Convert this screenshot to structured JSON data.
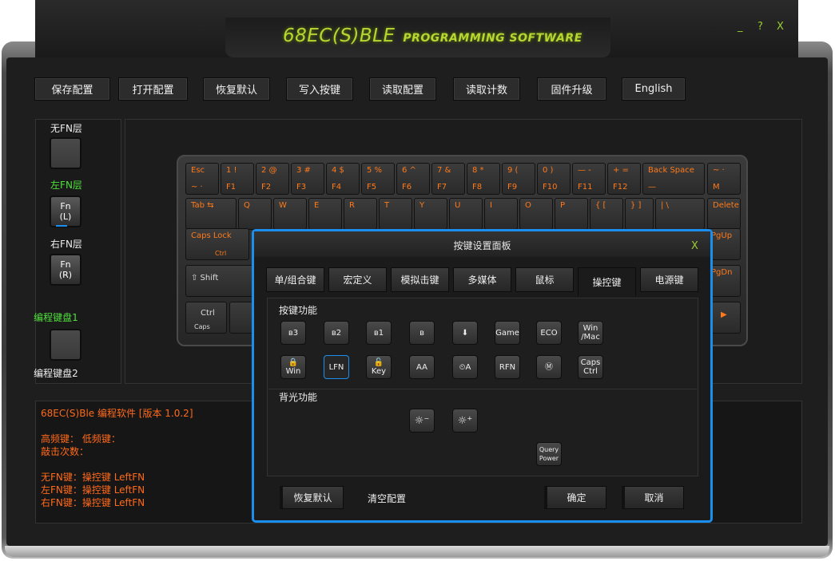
{
  "app": {
    "title_main": "68EC(S)BLE",
    "title_sub": "PROGRAMMING SOFTWARE",
    "min_label": "_",
    "help_label": "?",
    "close_label": "X"
  },
  "toolbar": [
    "保存配置",
    "打开配置",
    "恢复默认",
    "写入按键",
    "读取配置",
    "读取计数",
    "固件升级",
    "English"
  ],
  "layers": {
    "no_fn": "无FN层",
    "left_fn": "左FN层",
    "left_fn_key": "Fn",
    "left_fn_sub": "(L)",
    "right_fn": "右FN层",
    "right_fn_key": "Fn",
    "right_fn_sub": "(R)",
    "kb1": "编程键盘1",
    "kb2": "编程键盘2"
  },
  "keyboard": {
    "row1": [
      {
        "t": "Esc",
        "b": "~ ·"
      },
      {
        "t": "1 !",
        "b": "F1"
      },
      {
        "t": "2 @",
        "b": "F2"
      },
      {
        "t": "3 #",
        "b": "F3"
      },
      {
        "t": "4 $",
        "b": "F4"
      },
      {
        "t": "5 %",
        "b": "F5"
      },
      {
        "t": "6 ^",
        "b": "F6"
      },
      {
        "t": "7 &",
        "b": "F7"
      },
      {
        "t": "8 *",
        "b": "F8"
      },
      {
        "t": "9 (",
        "b": "F9"
      },
      {
        "t": "0 )",
        "b": "F10"
      },
      {
        "t": "— -",
        "b": "F11"
      },
      {
        "t": "+ =",
        "b": "F12"
      },
      {
        "t": "Back Space",
        "b": "—"
      },
      {
        "t": "~ ·",
        "b": "M"
      }
    ],
    "row2": [
      {
        "t": "Tab ⇆",
        "b": ""
      },
      {
        "t": "Q",
        "b": ""
      },
      {
        "t": "W",
        "b": ""
      },
      {
        "t": "E",
        "b": ""
      },
      {
        "t": "R",
        "b": ""
      },
      {
        "t": "T",
        "b": ""
      },
      {
        "t": "Y",
        "b": ""
      },
      {
        "t": "U",
        "b": ""
      },
      {
        "t": "I",
        "b": ""
      },
      {
        "t": "O",
        "b": ""
      },
      {
        "t": "P",
        "b": ""
      },
      {
        "t": "{ [",
        "b": ""
      },
      {
        "t": "} ]",
        "b": ""
      },
      {
        "t": "| \\",
        "b": ""
      },
      {
        "t": "Delete",
        "b": ""
      }
    ],
    "caps": "Caps Lock",
    "caps_sub": "Ctrl",
    "pgup": "PgUp",
    "shift": "⇧ Shift",
    "pgdn": "PgDn",
    "ctrl": "Ctrl",
    "ctrl_sub": "Caps"
  },
  "info": {
    "line1": "68EC(S)Ble 编程软件 [版本 1.0.2]",
    "line2": "高频键：    低频键：",
    "line3": "敲击次数：",
    "line4": "无FN键：操控键 LeftFN",
    "line5": "左FN键：操控键 LeftFN",
    "line6": "右FN键：操控键 LeftFN"
  },
  "dialog": {
    "title": "按键设置面板",
    "close": "X",
    "tabs": [
      "单/组合键",
      "宏定义",
      "模拟击键",
      "多媒体",
      "鼠标",
      "操控键",
      "电源键"
    ],
    "active_tab": "操控键",
    "section_keys": "按键功能",
    "section_backlight": "背光功能",
    "row1_icons": [
      {
        "name": "bt3",
        "label": "ʙ3"
      },
      {
        "name": "bt2",
        "label": "ʙ2"
      },
      {
        "name": "bt1",
        "label": "ʙ1"
      },
      {
        "name": "bt-pair",
        "label": "ʙ"
      },
      {
        "name": "download",
        "label": "⬇"
      },
      {
        "name": "game",
        "label": "Game"
      },
      {
        "name": "eco",
        "label": "ECO"
      },
      {
        "name": "win-mac",
        "label": "Win /Mac"
      }
    ],
    "row2_icons": [
      {
        "name": "lock-win",
        "label": "🔒Win"
      },
      {
        "name": "lfn",
        "label": "LFN"
      },
      {
        "name": "lock-key",
        "label": "🔓Key"
      },
      {
        "name": "font-a",
        "label": "AA"
      },
      {
        "name": "clock-a",
        "label": "⏲A"
      },
      {
        "name": "rfn",
        "label": "RFN"
      },
      {
        "name": "m",
        "label": "Ⓜ"
      },
      {
        "name": "caps-ctrl",
        "label": "Caps Ctrl"
      }
    ],
    "backlight_down": "☼⁻",
    "backlight_up": "☼⁺",
    "query_power": "Query Power",
    "restore": "恢复默认",
    "clear": "清空配置",
    "ok": "确定",
    "cancel": "取消"
  }
}
